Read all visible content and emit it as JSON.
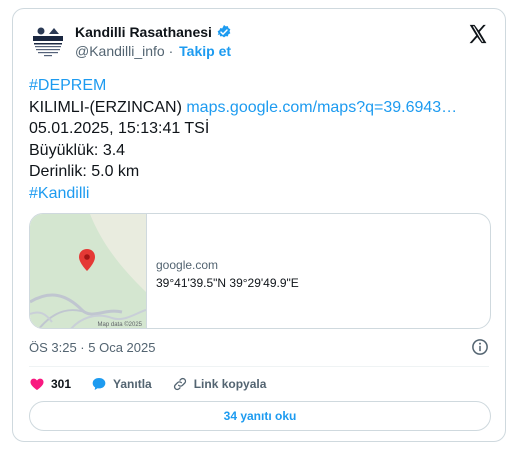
{
  "account": {
    "display_name": "Kandilli Rasathanesi",
    "handle": "@Kandilli_info",
    "separator": "·",
    "follow_label": "Takip et",
    "avatar_icon": "kandilli-logo-icon",
    "verified_icon": "verified-badge-icon",
    "verified_color": "#1d9bf0"
  },
  "platform_icon": "x-logo-icon",
  "tweet": {
    "hashtag_deprem": "#DEPREM",
    "location_text": "KILIMLI-(ERZINCAN) ",
    "map_link": "maps.google.com/maps?q=39.6943…",
    "datetime": "05.01.2025, 15:13:41 TSİ",
    "magnitude": "Büyüklük: 3.4",
    "depth": "Derinlik: 5.0 km",
    "hashtag_kandilli": "#Kandilli"
  },
  "map_card": {
    "domain": "google.com",
    "coordinates": "39°41'39.5\"N 39°29'49.9\"E",
    "map_attribution": "Map data ©2025",
    "pin_color": "#e53935"
  },
  "timestamp": "ÖS 3:25 · 5 Oca 2025",
  "actions": {
    "like_count": "301",
    "reply_label": "Yanıtla",
    "copy_link_label": "Link kopyala",
    "like_color": "#f91880",
    "reply_color": "#1d9bf0"
  },
  "read_replies_label": "34 yanıtı oku",
  "accent_color": "#1d9bf0"
}
